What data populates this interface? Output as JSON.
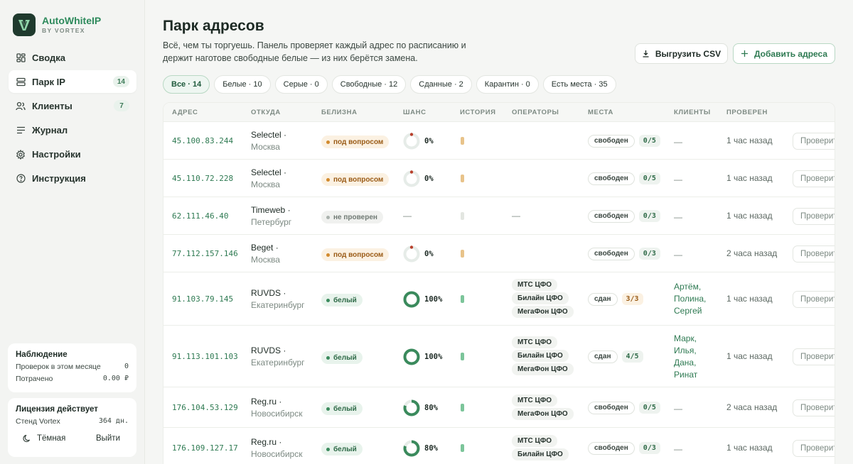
{
  "brand": {
    "name": "AutoWhiteIP",
    "sub": "BY VORTEX"
  },
  "nav": [
    {
      "label": "Сводка",
      "icon": "dashboard-icon",
      "badge": ""
    },
    {
      "label": "Парк IP",
      "icon": "server-icon",
      "badge": "14"
    },
    {
      "label": "Клиенты",
      "icon": "users-icon",
      "badge": "7"
    },
    {
      "label": "Журнал",
      "icon": "list-icon",
      "badge": ""
    },
    {
      "label": "Настройки",
      "icon": "gear-icon",
      "badge": ""
    },
    {
      "label": "Инструкция",
      "icon": "help-icon",
      "badge": ""
    }
  ],
  "observation": {
    "title": "Наблюдение",
    "checks_label": "Проверок в этом месяце",
    "checks_value": "0",
    "spent_label": "Потрачено",
    "spent_value": "0.00 ₽"
  },
  "license": {
    "title": "Лицензия действует",
    "stand_label": "Стенд Vortex",
    "stand_value": "364 дн.",
    "theme_label": "Тёмная",
    "logout_label": "Выйти"
  },
  "page": {
    "title": "Парк адресов",
    "description": "Всё, чем ты торгуешь. Панель проверяет каждый адрес по расписанию и держит наготове свободные белые — из них берётся замена.",
    "export_label": "Выгрузить CSV",
    "add_label": "Добавить адреса"
  },
  "filters": [
    "Все · 14",
    "Белые · 10",
    "Серые · 0",
    "Свободные · 12",
    "Сданные · 2",
    "Карантин · 0",
    "Есть места · 35"
  ],
  "columns": {
    "address": "АДРЕС",
    "source": "ОТКУДА",
    "whiteness": "БЕЛИЗНА",
    "chance": "ШАНС",
    "history": "ИСТОРИЯ",
    "operators": "ОПЕРАТОРЫ",
    "places": "МЕСТА",
    "clients": "КЛИЕНТЫ",
    "checked": "ПРОВЕРЕН"
  },
  "check_button_label": "Проверить",
  "colors": {
    "accent": "#2e8a5c",
    "question": "#d28a2d",
    "white_status": "#3a8a5c",
    "not_checked": "#aab2ad",
    "chance_red": "#b8402c"
  },
  "rows": [
    {
      "ip": "45.100.83.244",
      "provider": "Selectel ·",
      "city": "Москва",
      "status": "под вопросом",
      "status_kind": "q",
      "chance": "0%",
      "chance_value": 0,
      "history": "amber",
      "operators": [],
      "ops_dash": "",
      "place_state": "свободен",
      "place_count": "0/5",
      "place_amber": false,
      "clients": [],
      "checked": "1 час назад"
    },
    {
      "ip": "45.110.72.228",
      "provider": "Selectel ·",
      "city": "Москва",
      "status": "под вопросом",
      "status_kind": "q",
      "chance": "0%",
      "chance_value": 0,
      "history": "amber",
      "operators": [],
      "ops_dash": "",
      "place_state": "свободен",
      "place_count": "0/5",
      "place_amber": false,
      "clients": [],
      "checked": "1 час назад"
    },
    {
      "ip": "62.111.46.40",
      "provider": "Timeweb ·",
      "city": "Петербург",
      "status": "не проверен",
      "status_kind": "n",
      "chance": "—",
      "chance_value": -1,
      "history": "grey",
      "operators": [],
      "ops_dash": "—",
      "place_state": "свободен",
      "place_count": "0/3",
      "place_amber": false,
      "clients": [],
      "checked": "1 час назад"
    },
    {
      "ip": "77.112.157.146",
      "provider": "Beget ·",
      "city": "Москва",
      "status": "под вопросом",
      "status_kind": "q",
      "chance": "0%",
      "chance_value": 0,
      "history": "amber",
      "operators": [],
      "ops_dash": "",
      "place_state": "свободен",
      "place_count": "0/3",
      "place_amber": false,
      "clients": [],
      "checked": "2 часа назад"
    },
    {
      "ip": "91.103.79.145",
      "provider": "RUVDS ·",
      "city": "Екатеринбург",
      "status": "белый",
      "status_kind": "w",
      "chance": "100%",
      "chance_value": 100,
      "history": "green",
      "operators": [
        "МТС ЦФО",
        "Билайн ЦФО",
        "МегаФон ЦФО"
      ],
      "ops_dash": "",
      "place_state": "сдан",
      "place_count": "3/3",
      "place_amber": true,
      "clients": [
        "Артём,",
        "Полина,",
        "Сергей"
      ],
      "checked": "1 час назад"
    },
    {
      "ip": "91.113.101.103",
      "provider": "RUVDS ·",
      "city": "Екатеринбург",
      "status": "белый",
      "status_kind": "w",
      "chance": "100%",
      "chance_value": 100,
      "history": "green",
      "operators": [
        "МТС ЦФО",
        "Билайн ЦФО",
        "МегаФон ЦФО"
      ],
      "ops_dash": "",
      "place_state": "сдан",
      "place_count": "4/5",
      "place_amber": false,
      "clients": [
        "Марк,",
        "Илья,",
        "Дана,",
        "Ринат"
      ],
      "checked": "1 час назад"
    },
    {
      "ip": "176.104.53.129",
      "provider": "Reg.ru ·",
      "city": "Новосибирск",
      "status": "белый",
      "status_kind": "w",
      "chance": "80%",
      "chance_value": 80,
      "history": "green",
      "operators": [
        "МТС ЦФО",
        "МегаФон ЦФО"
      ],
      "ops_dash": "",
      "place_state": "свободен",
      "place_count": "0/5",
      "place_amber": false,
      "clients": [],
      "checked": "2 часа назад"
    },
    {
      "ip": "176.109.127.17",
      "provider": "Reg.ru ·",
      "city": "Новосибирск",
      "status": "белый",
      "status_kind": "w",
      "chance": "80%",
      "chance_value": 80,
      "history": "green",
      "operators": [
        "МТС ЦФО",
        "Билайн ЦФО"
      ],
      "ops_dash": "",
      "place_state": "свободен",
      "place_count": "0/3",
      "place_amber": false,
      "clients": [],
      "checked": "1 час назад"
    }
  ],
  "empty_dash": "—"
}
